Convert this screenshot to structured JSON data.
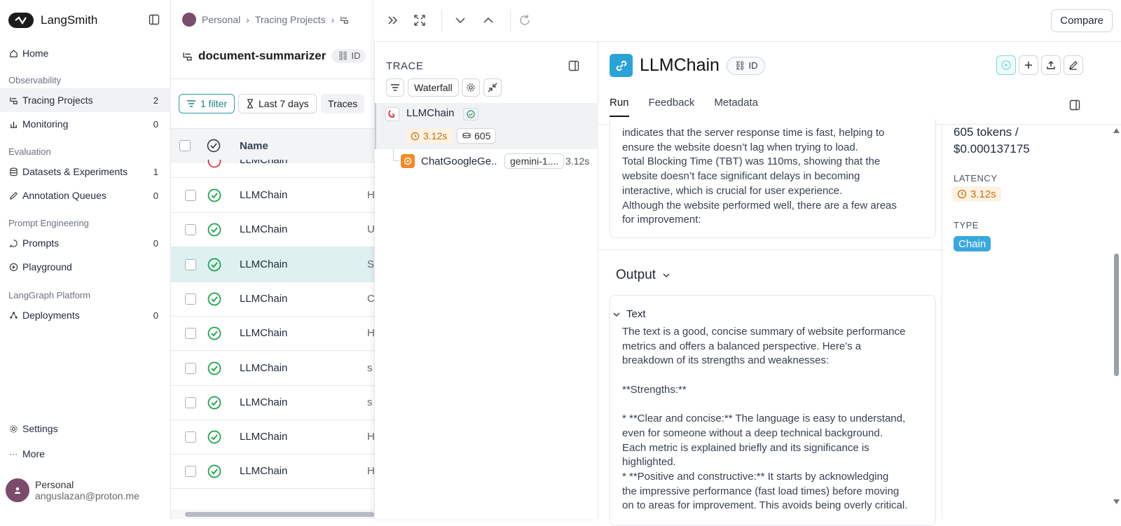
{
  "sidebar": {
    "brand": "LangSmith",
    "home": "Home",
    "sections": [
      "Observability",
      "Evaluation",
      "Prompt Engineering",
      "LangGraph Platform"
    ],
    "items": [
      {
        "label": "Tracing Projects",
        "count": "2"
      },
      {
        "label": "Monitoring",
        "count": "0"
      },
      {
        "label": "Datasets & Experiments",
        "count": "1"
      },
      {
        "label": "Annotation Queues",
        "count": "0"
      },
      {
        "label": "Prompts",
        "count": "0"
      },
      {
        "label": "Playground",
        "count": ""
      },
      {
        "label": "Deployments",
        "count": "0"
      }
    ],
    "settings": "Settings",
    "more": "More",
    "user": {
      "name": "Personal",
      "email": "anguslazan@proton.me"
    }
  },
  "project": {
    "breadcrumb": [
      "Personal",
      "Tracing Projects"
    ],
    "title": "document-summarizer",
    "id_label": "ID",
    "filter_label": "1 filter",
    "range_label": "Last 7 days",
    "traces_label": "Traces",
    "column_name": "Name",
    "rows": [
      "LLMChain",
      "LLMChain",
      "LLMChain",
      "LLMChain",
      "LLMChain",
      "LLMChain",
      "LLMChain",
      "LLMChain",
      "LLMChain",
      "LLMChain"
    ],
    "row_trunc": [
      "H",
      "U",
      "S",
      "C",
      "H",
      "s",
      "s",
      "H",
      "H"
    ]
  },
  "trace": {
    "label": "TRACE",
    "view": "Waterfall",
    "root": {
      "name": "LLMChain",
      "latency": "3.12s",
      "tokens": "605"
    },
    "child": {
      "name": "ChatGoogleGe...",
      "model": "gemini-1....",
      "latency": "3.12s"
    },
    "compare": "Compare"
  },
  "detail": {
    "title": "LLMChain",
    "id_label": "ID",
    "tabs": [
      "Run",
      "Feedback",
      "Metadata"
    ],
    "input_text": [
      "indicates that the server response time is fast, helping to",
      "ensure the website doesn’t lag when trying to load.",
      "Total Blocking Time (TBT) was 110ms, showing that the",
      "website doesn’t face significant delays in becoming",
      "interactive, which is crucial for user experience.",
      "Although the website performed well, there are a few areas",
      "for improvement:"
    ],
    "output_heading": "Output",
    "text_heading": "Text",
    "output_text": [
      "The text is a good, concise summary of website performance",
      "metrics and offers a balanced perspective.  Here's a",
      "breakdown of its strengths and weaknesses:",
      "",
      "**Strengths:**",
      "",
      "* **Clear and concise:** The language is easy to understand,",
      "even for someone without a deep technical background.",
      "Each metric is explained briefly and its significance is",
      "highlighted.",
      "* **Positive and constructive:** It starts by acknowledging",
      "the impressive performance (fast load times) before moving",
      "on to areas for improvement. This avoids being overly critical."
    ],
    "tokens_line1": "605 tokens /",
    "tokens_line2": "$0.000137175",
    "latency_label": "LATENCY",
    "latency": "3.12s",
    "type_label": "TYPE",
    "type": "Chain"
  }
}
